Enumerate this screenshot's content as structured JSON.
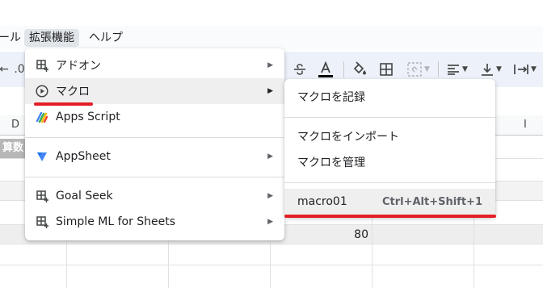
{
  "menubar": {
    "tools_partial": "ール",
    "extensions": "拡張機能",
    "help": "ヘルプ"
  },
  "toolbar": {
    "partial_left": ".0",
    "partial_left_arrow": "←",
    "icons": [
      "strikethrough-icon",
      "text-color-icon",
      "fill-color-icon",
      "borders-icon",
      "merge-cells-icon",
      "horizontal-align-icon",
      "vertical-align-icon",
      "text-rotation-icon"
    ]
  },
  "grid": {
    "col_labels": {
      "d": "D",
      "i": "I"
    },
    "dark_cell_text": "算数",
    "value_cell": "80"
  },
  "extensions_menu": {
    "items": [
      {
        "label": "アドオン",
        "icon": "add-ons-icon",
        "has_submenu": true
      },
      {
        "label": "マクロ",
        "icon": "macro-play-icon",
        "has_submenu": true,
        "highlighted": true
      },
      {
        "label": "Apps Script",
        "icon": "apps-script-icon",
        "has_submenu": false
      },
      {
        "label": "AppSheet",
        "icon": "appsheet-icon",
        "has_submenu": true
      },
      {
        "label": "Goal Seek",
        "icon": "add-on-grid-icon",
        "has_submenu": true
      },
      {
        "label": "Simple ML for Sheets",
        "icon": "add-on-grid-icon",
        "has_submenu": true
      }
    ],
    "arrow": "▶"
  },
  "macro_submenu": {
    "record": "マクロを記録",
    "import": "マクロをインポート",
    "manage": "マクロを管理",
    "macro_name": "macro01",
    "macro_shortcut": "Ctrl+Alt+Shift+1"
  },
  "colors": {
    "accent_underline": "#e41e26",
    "menu_hover": "#efefef",
    "toolbar_bg": "#edf2fa",
    "appsheet_blue": "#4285f4"
  }
}
